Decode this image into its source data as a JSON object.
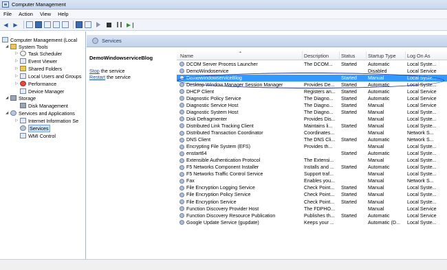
{
  "window": {
    "title": "Computer Management"
  },
  "menubar": {
    "items": [
      "File",
      "Action",
      "View",
      "Help"
    ]
  },
  "tree": {
    "items": [
      {
        "label": "Computer Management (Local",
        "icon": "computer-icon"
      },
      {
        "label": "System Tools",
        "icon": "tools-icon"
      },
      {
        "label": "Task Scheduler",
        "icon": "clock-icon"
      },
      {
        "label": "Event Viewer",
        "icon": "event-viewer-icon"
      },
      {
        "label": "Shared Folders",
        "icon": "folder-icon"
      },
      {
        "label": "Local Users and Groups",
        "icon": "users-icon"
      },
      {
        "label": "Performance",
        "icon": "performance-icon"
      },
      {
        "label": "Device Manager",
        "icon": "device-icon"
      },
      {
        "label": "Storage",
        "icon": "storage-icon"
      },
      {
        "label": "Disk Management",
        "icon": "disk-icon"
      },
      {
        "label": "Services and Applications",
        "icon": "services-apps-icon"
      },
      {
        "label": "Internet Information Se",
        "icon": "iis-icon"
      },
      {
        "label": "Services",
        "icon": "services-icon"
      },
      {
        "label": "WMI Control",
        "icon": "wmi-icon"
      }
    ]
  },
  "header": {
    "title": "Services"
  },
  "description_pane": {
    "service_name": "DemoWindowserviceBlog",
    "stop_link": "Stop",
    "stop_rest": " the service",
    "restart_link": "Restart",
    "restart_rest": " the service"
  },
  "grid": {
    "columns": [
      "Name",
      "Description",
      "Status",
      "Startup Type",
      "Log On As"
    ],
    "selected_index": 2,
    "rows": [
      {
        "name": "DCOM Server Process Launcher",
        "description": "The DCOM...",
        "status": "Started",
        "startup": "Automatic",
        "logon": "Local Syste..."
      },
      {
        "name": "DemoWindoservice",
        "description": "",
        "status": "",
        "startup": "Disabled",
        "logon": "Local Service"
      },
      {
        "name": "DemoWindowserviceBlog",
        "description": "",
        "status": "Started",
        "startup": "Manual",
        "logon": "Local Syste..."
      },
      {
        "name": "Desktop Window Manager Session Manager",
        "description": "Provides De...",
        "status": "Started",
        "startup": "Automatic",
        "logon": "Local Syste..."
      },
      {
        "name": "DHCP Client",
        "description": "Registers an...",
        "status": "Started",
        "startup": "Automatic",
        "logon": "Local Service"
      },
      {
        "name": "Diagnostic Policy Service",
        "description": "The Diagno...",
        "status": "Started",
        "startup": "Automatic",
        "logon": "Local Service"
      },
      {
        "name": "Diagnostic Service Host",
        "description": "The Diagno...",
        "status": "Started",
        "startup": "Manual",
        "logon": "Local Service"
      },
      {
        "name": "Diagnostic System Host",
        "description": "The Diagno...",
        "status": "Started",
        "startup": "Manual",
        "logon": "Local Syste..."
      },
      {
        "name": "Disk Defragmenter",
        "description": "Provides Dis...",
        "status": "",
        "startup": "Manual",
        "logon": "Local Syste..."
      },
      {
        "name": "Distributed Link Tracking Client",
        "description": "Maintains li...",
        "status": "Started",
        "startup": "Manual",
        "logon": "Local Syste..."
      },
      {
        "name": "Distributed Transaction Coordinator",
        "description": "Coordinates...",
        "status": "",
        "startup": "Manual",
        "logon": "Network S..."
      },
      {
        "name": "DNS Client",
        "description": "The DNS Cli...",
        "status": "Started",
        "startup": "Automatic",
        "logon": "Network S..."
      },
      {
        "name": "Encrypting File System (EFS)",
        "description": "Provides th...",
        "status": "",
        "startup": "Manual",
        "logon": "Local Syste..."
      },
      {
        "name": "enstart64",
        "description": "",
        "status": "Started",
        "startup": "Automatic",
        "logon": "Local Syste..."
      },
      {
        "name": "Extensible Authentication Protocol",
        "description": "The Extensi...",
        "status": "",
        "startup": "Manual",
        "logon": "Local Syste..."
      },
      {
        "name": "F5 Networks Component Installer",
        "description": "Installs and ...",
        "status": "Started",
        "startup": "Automatic",
        "logon": "Local Syste..."
      },
      {
        "name": "F5 Networks Traffic Control Service",
        "description": "Support traf...",
        "status": "",
        "startup": "Manual",
        "logon": "Local Syste..."
      },
      {
        "name": "Fax",
        "description": "Enables you...",
        "status": "",
        "startup": "Manual",
        "logon": "Network S..."
      },
      {
        "name": "File Encryption Logging Service",
        "description": "Check Point...",
        "status": "Started",
        "startup": "Manual",
        "logon": "Local Syste..."
      },
      {
        "name": "File Encryption Policy Service",
        "description": "Check Point...",
        "status": "Started",
        "startup": "Manual",
        "logon": "Local Syste..."
      },
      {
        "name": "File Encryption Service",
        "description": "Check Point...",
        "status": "Started",
        "startup": "Manual",
        "logon": "Local Syste..."
      },
      {
        "name": "Function Discovery Provider Host",
        "description": "The FDPHO...",
        "status": "",
        "startup": "Manual",
        "logon": "Local Service"
      },
      {
        "name": "Function Discovery Resource Publication",
        "description": "Publishes th...",
        "status": "Started",
        "startup": "Automatic",
        "logon": "Local Service"
      },
      {
        "name": "Google Update Service (gupdate)",
        "description": "Keeps your ...",
        "status": "",
        "startup": "Automatic (D...",
        "logon": "Local Syste..."
      }
    ]
  },
  "colors": {
    "selection": "#3399ff",
    "annotation": "#2233aa",
    "link": "#1a4fb0"
  }
}
